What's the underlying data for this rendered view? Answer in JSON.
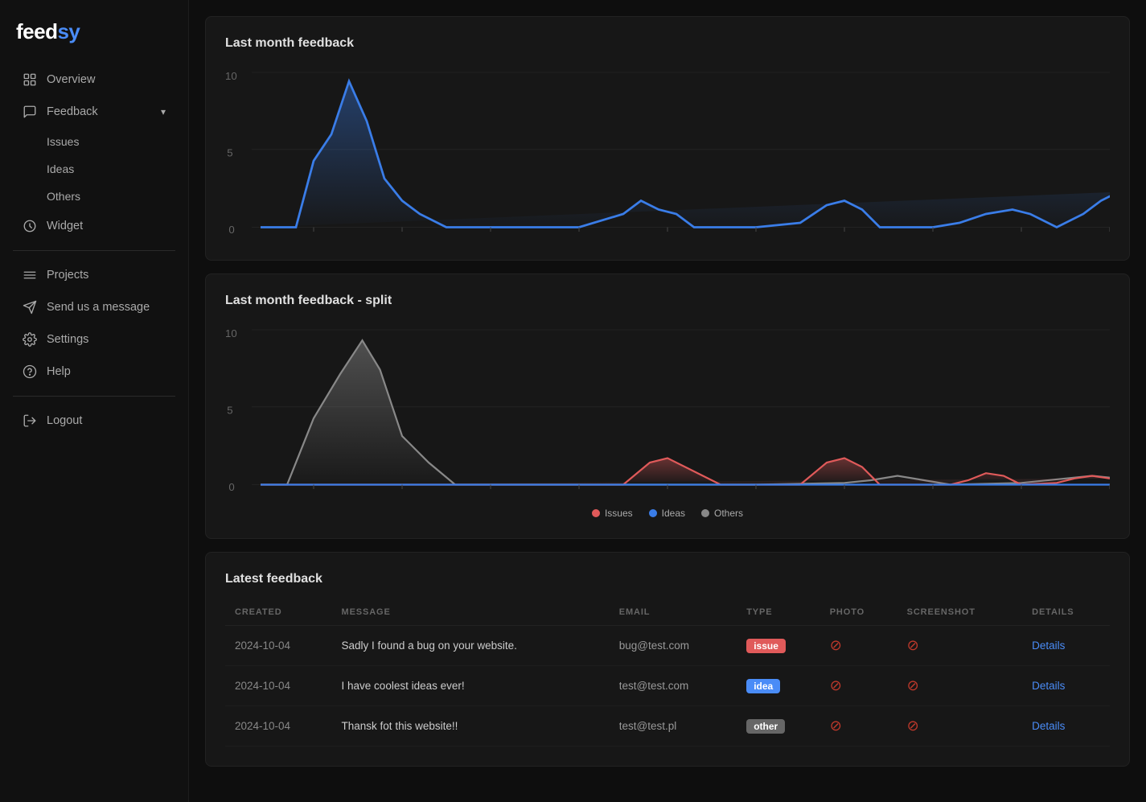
{
  "app": {
    "name": "feedsy",
    "brand_color": "#4a8cf7"
  },
  "sidebar": {
    "nav_items": [
      {
        "id": "overview",
        "label": "Overview",
        "icon": "overview",
        "has_sub": false,
        "divider_after": false
      },
      {
        "id": "feedback",
        "label": "Feedback",
        "icon": "feedback",
        "has_sub": true,
        "expanded": true,
        "divider_after": false
      },
      {
        "id": "widget",
        "label": "Widget",
        "icon": "widget",
        "has_sub": false,
        "divider_after": true
      },
      {
        "id": "projects",
        "label": "Projects",
        "icon": "projects",
        "has_sub": false,
        "divider_after": false
      },
      {
        "id": "send-message",
        "label": "Send us a message",
        "icon": "send",
        "has_sub": false,
        "divider_after": false
      },
      {
        "id": "settings",
        "label": "Settings",
        "icon": "settings",
        "has_sub": false,
        "divider_after": false
      },
      {
        "id": "help",
        "label": "Help",
        "icon": "help",
        "has_sub": false,
        "divider_after": true
      },
      {
        "id": "logout",
        "label": "Logout",
        "icon": "logout",
        "has_sub": false,
        "divider_after": false
      }
    ],
    "feedback_sub": [
      "Issues",
      "Ideas",
      "Others"
    ]
  },
  "chart1": {
    "title": "Last month feedback",
    "y_labels": [
      "10",
      "5",
      "0"
    ],
    "line_color": "#3a7de8"
  },
  "chart2": {
    "title": "Last month feedback - split",
    "y_labels": [
      "10",
      "5",
      "0"
    ],
    "legend": [
      {
        "label": "Issues",
        "color": "#e05a5a"
      },
      {
        "label": "Ideas",
        "color": "#3a7de8"
      },
      {
        "label": "Others",
        "color": "#888"
      }
    ]
  },
  "table": {
    "title": "Latest feedback",
    "columns": [
      "CREATED",
      "MESSAGE",
      "EMAIL",
      "TYPE",
      "PHOTO",
      "SCREENSHOT",
      "DETAILS"
    ],
    "rows": [
      {
        "created": "2024-10-04",
        "message": "Sadly I found a bug on your website.",
        "email": "bug@test.com",
        "type": "issue",
        "type_class": "issue",
        "photo": "no",
        "screenshot": "no",
        "details": "Details"
      },
      {
        "created": "2024-10-04",
        "message": "I have coolest ideas ever!",
        "email": "test@test.com",
        "type": "idea",
        "type_class": "idea",
        "photo": "no",
        "screenshot": "no",
        "details": "Details"
      },
      {
        "created": "2024-10-04",
        "message": "Thansk fot this website!!",
        "email": "test@test.pl",
        "type": "other",
        "type_class": "other",
        "photo": "no",
        "screenshot": "no",
        "details": "Details"
      }
    ]
  }
}
